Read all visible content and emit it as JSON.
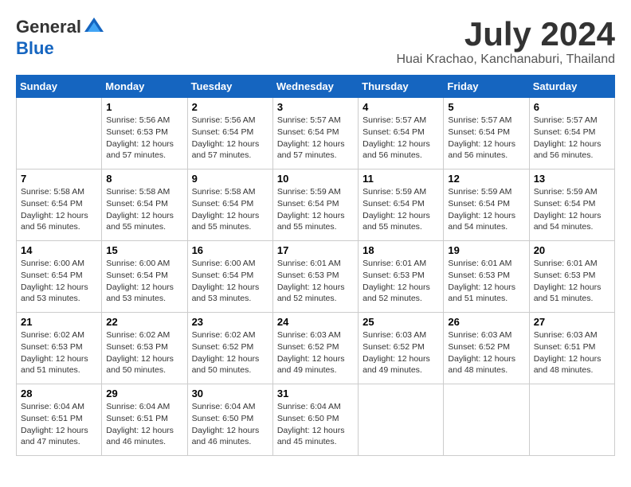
{
  "header": {
    "logo": {
      "general": "General",
      "blue": "Blue"
    },
    "title": "July 2024",
    "location": "Huai Krachao, Kanchanaburi, Thailand"
  },
  "calendar": {
    "days_of_week": [
      "Sunday",
      "Monday",
      "Tuesday",
      "Wednesday",
      "Thursday",
      "Friday",
      "Saturday"
    ],
    "weeks": [
      [
        {
          "day": "",
          "info": ""
        },
        {
          "day": "1",
          "info": "Sunrise: 5:56 AM\nSunset: 6:53 PM\nDaylight: 12 hours\nand 57 minutes."
        },
        {
          "day": "2",
          "info": "Sunrise: 5:56 AM\nSunset: 6:54 PM\nDaylight: 12 hours\nand 57 minutes."
        },
        {
          "day": "3",
          "info": "Sunrise: 5:57 AM\nSunset: 6:54 PM\nDaylight: 12 hours\nand 57 minutes."
        },
        {
          "day": "4",
          "info": "Sunrise: 5:57 AM\nSunset: 6:54 PM\nDaylight: 12 hours\nand 56 minutes."
        },
        {
          "day": "5",
          "info": "Sunrise: 5:57 AM\nSunset: 6:54 PM\nDaylight: 12 hours\nand 56 minutes."
        },
        {
          "day": "6",
          "info": "Sunrise: 5:57 AM\nSunset: 6:54 PM\nDaylight: 12 hours\nand 56 minutes."
        }
      ],
      [
        {
          "day": "7",
          "info": "Sunrise: 5:58 AM\nSunset: 6:54 PM\nDaylight: 12 hours\nand 56 minutes."
        },
        {
          "day": "8",
          "info": "Sunrise: 5:58 AM\nSunset: 6:54 PM\nDaylight: 12 hours\nand 55 minutes."
        },
        {
          "day": "9",
          "info": "Sunrise: 5:58 AM\nSunset: 6:54 PM\nDaylight: 12 hours\nand 55 minutes."
        },
        {
          "day": "10",
          "info": "Sunrise: 5:59 AM\nSunset: 6:54 PM\nDaylight: 12 hours\nand 55 minutes."
        },
        {
          "day": "11",
          "info": "Sunrise: 5:59 AM\nSunset: 6:54 PM\nDaylight: 12 hours\nand 55 minutes."
        },
        {
          "day": "12",
          "info": "Sunrise: 5:59 AM\nSunset: 6:54 PM\nDaylight: 12 hours\nand 54 minutes."
        },
        {
          "day": "13",
          "info": "Sunrise: 5:59 AM\nSunset: 6:54 PM\nDaylight: 12 hours\nand 54 minutes."
        }
      ],
      [
        {
          "day": "14",
          "info": "Sunrise: 6:00 AM\nSunset: 6:54 PM\nDaylight: 12 hours\nand 53 minutes."
        },
        {
          "day": "15",
          "info": "Sunrise: 6:00 AM\nSunset: 6:54 PM\nDaylight: 12 hours\nand 53 minutes."
        },
        {
          "day": "16",
          "info": "Sunrise: 6:00 AM\nSunset: 6:54 PM\nDaylight: 12 hours\nand 53 minutes."
        },
        {
          "day": "17",
          "info": "Sunrise: 6:01 AM\nSunset: 6:53 PM\nDaylight: 12 hours\nand 52 minutes."
        },
        {
          "day": "18",
          "info": "Sunrise: 6:01 AM\nSunset: 6:53 PM\nDaylight: 12 hours\nand 52 minutes."
        },
        {
          "day": "19",
          "info": "Sunrise: 6:01 AM\nSunset: 6:53 PM\nDaylight: 12 hours\nand 51 minutes."
        },
        {
          "day": "20",
          "info": "Sunrise: 6:01 AM\nSunset: 6:53 PM\nDaylight: 12 hours\nand 51 minutes."
        }
      ],
      [
        {
          "day": "21",
          "info": "Sunrise: 6:02 AM\nSunset: 6:53 PM\nDaylight: 12 hours\nand 51 minutes."
        },
        {
          "day": "22",
          "info": "Sunrise: 6:02 AM\nSunset: 6:53 PM\nDaylight: 12 hours\nand 50 minutes."
        },
        {
          "day": "23",
          "info": "Sunrise: 6:02 AM\nSunset: 6:52 PM\nDaylight: 12 hours\nand 50 minutes."
        },
        {
          "day": "24",
          "info": "Sunrise: 6:03 AM\nSunset: 6:52 PM\nDaylight: 12 hours\nand 49 minutes."
        },
        {
          "day": "25",
          "info": "Sunrise: 6:03 AM\nSunset: 6:52 PM\nDaylight: 12 hours\nand 49 minutes."
        },
        {
          "day": "26",
          "info": "Sunrise: 6:03 AM\nSunset: 6:52 PM\nDaylight: 12 hours\nand 48 minutes."
        },
        {
          "day": "27",
          "info": "Sunrise: 6:03 AM\nSunset: 6:51 PM\nDaylight: 12 hours\nand 48 minutes."
        }
      ],
      [
        {
          "day": "28",
          "info": "Sunrise: 6:04 AM\nSunset: 6:51 PM\nDaylight: 12 hours\nand 47 minutes."
        },
        {
          "day": "29",
          "info": "Sunrise: 6:04 AM\nSunset: 6:51 PM\nDaylight: 12 hours\nand 46 minutes."
        },
        {
          "day": "30",
          "info": "Sunrise: 6:04 AM\nSunset: 6:50 PM\nDaylight: 12 hours\nand 46 minutes."
        },
        {
          "day": "31",
          "info": "Sunrise: 6:04 AM\nSunset: 6:50 PM\nDaylight: 12 hours\nand 45 minutes."
        },
        {
          "day": "",
          "info": ""
        },
        {
          "day": "",
          "info": ""
        },
        {
          "day": "",
          "info": ""
        }
      ]
    ]
  }
}
